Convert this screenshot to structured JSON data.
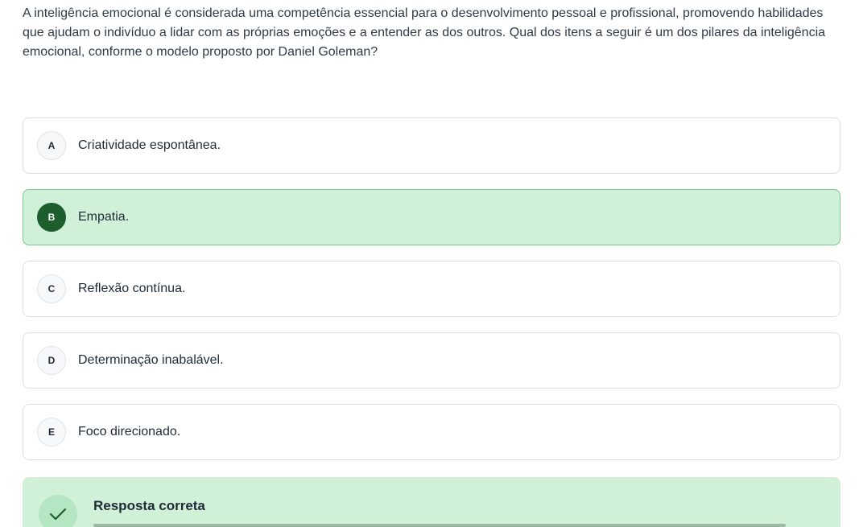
{
  "question": {
    "text": "A inteligência emocional é considerada uma competência essencial para o desenvolvimento pessoal e profissional, promovendo habilidades que ajudam o indivíduo a lidar com as próprias emoções e a entender as dos outros. Qual dos itens a seguir é um dos pilares da inteligência emocional, conforme o modelo proposto por Daniel Goleman?"
  },
  "options": [
    {
      "letter": "A",
      "text": "Criatividade espontânea.",
      "selected": false
    },
    {
      "letter": "B",
      "text": "Empatia.",
      "selected": true
    },
    {
      "letter": "C",
      "text": "Reflexão contínua.",
      "selected": false
    },
    {
      "letter": "D",
      "text": "Determinação inabalável.",
      "selected": false
    },
    {
      "letter": "E",
      "text": "Foco direcionado.",
      "selected": false
    }
  ],
  "feedback": {
    "title": "Resposta correta",
    "icon": "check-icon"
  },
  "colors": {
    "selected_bg": "#d0f0d8",
    "selected_border": "#78c78f",
    "selected_letter_bg": "#1c5e2e",
    "check_color": "#1c5e2e"
  }
}
